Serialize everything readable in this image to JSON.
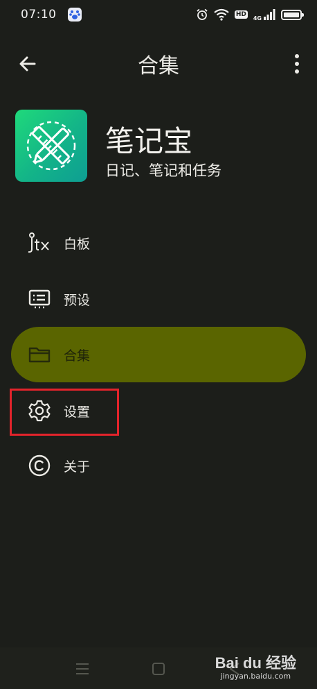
{
  "status_bar": {
    "time": "07:10",
    "hd_label": "HD",
    "network_label": "4G"
  },
  "app_bar": {
    "title": "合集",
    "back_icon": "arrow-left-icon",
    "more_icon": "more-vert-icon"
  },
  "app_info": {
    "name": "笔记宝",
    "tagline": "日记、笔记和任务"
  },
  "menu": {
    "items": [
      {
        "label": "白板",
        "icon": "jtx-logo-icon",
        "active": false
      },
      {
        "label": "预设",
        "icon": "preset-list-icon",
        "active": false
      },
      {
        "label": "合集",
        "icon": "folder-icon",
        "active": true
      },
      {
        "label": "设置",
        "icon": "gear-icon",
        "active": false
      },
      {
        "label": "关于",
        "icon": "copyright-icon",
        "active": false
      }
    ]
  },
  "watermark": {
    "logo_text": "Bai du 经验",
    "url": "jingyan.baidu.com"
  },
  "colors": {
    "background": "#1c1e1a",
    "active_item": "#5a6500",
    "highlight": "#e3242b",
    "logo_gradient_start": "#1fd97b",
    "logo_gradient_end": "#0e9e93"
  }
}
